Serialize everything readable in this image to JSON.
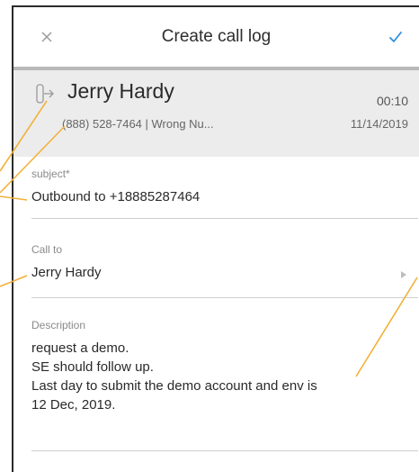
{
  "header": {
    "title": "Create call log",
    "close_icon": "close-icon",
    "confirm_icon": "check-icon"
  },
  "call": {
    "direction_icon": "outbound-call-icon",
    "contact_name": "Jerry Hardy",
    "duration": "00:10",
    "phone_and_result": "(888) 528-7464 | Wrong Nu...",
    "date": "11/14/2019"
  },
  "form": {
    "subject_label": "subject*",
    "subject_value": "Outbound to +18885287464",
    "call_to_label": "Call to",
    "call_to_value": "Jerry Hardy",
    "description_label": "Description",
    "description_lines": [
      "request a demo.",
      "SE should follow up.",
      "Last day to submit the demo account and env is",
      "12 Dec, 2019."
    ]
  },
  "colors": {
    "accent": "#2f8fdc",
    "callout": "#f2b13a",
    "band": "#ececec",
    "divider": "#b9b9b9"
  }
}
